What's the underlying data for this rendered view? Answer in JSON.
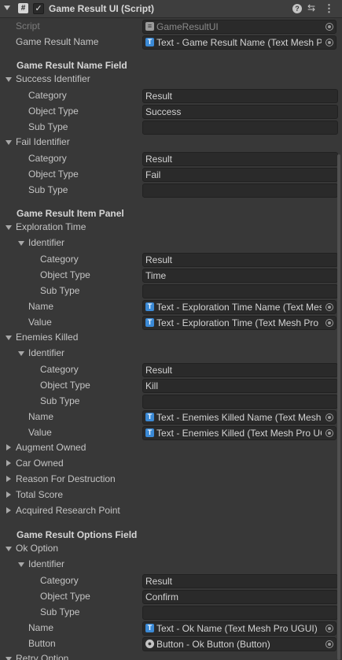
{
  "component": {
    "title": "Game Result UI (Script)",
    "script_icon": "#",
    "enabled_check": "✓",
    "help_icon": "?",
    "preset_icon": "⇆",
    "menu_icon": "⋮"
  },
  "script": {
    "label": "Script",
    "value": "GameResultUI"
  },
  "game_result_name": {
    "label": "Game Result Name",
    "value": "Text - Game Result Name (Text Mesh Pro UGUI)"
  },
  "name_field": {
    "header": "Game Result Name Field",
    "success": {
      "label": "Success Identifier",
      "category_label": "Category",
      "category": "Result",
      "object_type_label": "Object Type",
      "object_type": "Success",
      "sub_type_label": "Sub Type",
      "sub_type": ""
    },
    "fail": {
      "label": "Fail Identifier",
      "category_label": "Category",
      "category": "Result",
      "object_type_label": "Object Type",
      "object_type": "Fail",
      "sub_type_label": "Sub Type",
      "sub_type": ""
    }
  },
  "item_panel": {
    "header": "Game Result Item Panel",
    "exploration_time": {
      "label": "Exploration Time",
      "identifier_label": "Identifier",
      "category_label": "Category",
      "category": "Result",
      "object_type_label": "Object Type",
      "object_type": "Time",
      "sub_type_label": "Sub Type",
      "sub_type": "",
      "name_label": "Name",
      "name": "Text - Exploration Time  Name (Text Mesh Pro UGUI)",
      "value_label": "Value",
      "value": "Text - Exploration Time (Text Mesh Pro UGUI)"
    },
    "enemies_killed": {
      "label": "Enemies Killed",
      "identifier_label": "Identifier",
      "category_label": "Category",
      "category": "Result",
      "object_type_label": "Object Type",
      "object_type": "Kill",
      "sub_type_label": "Sub Type",
      "sub_type": "",
      "name_label": "Name",
      "name": "Text - Enemies Killed Name (Text Mesh Pro UGUI)",
      "value_label": "Value",
      "value": "Text - Enemies Killed (Text Mesh Pro UGUI)"
    },
    "collapsed": [
      "Augment Owned",
      "Car Owned",
      "Reason For Destruction",
      "Total Score",
      "Acquired Research Point"
    ]
  },
  "options_field": {
    "header": "Game Result Options Field",
    "ok_option": {
      "label": "Ok Option",
      "identifier_label": "Identifier",
      "category_label": "Category",
      "category": "Result",
      "object_type_label": "Object Type",
      "object_type": "Confirm",
      "sub_type_label": "Sub Type",
      "sub_type": "",
      "name_label": "Name",
      "name": "Text - Ok Name (Text Mesh Pro UGUI)",
      "button_label": "Button",
      "button": "Button - Ok Button (Button)"
    },
    "retry_option": {
      "label": "Retry Option"
    }
  }
}
